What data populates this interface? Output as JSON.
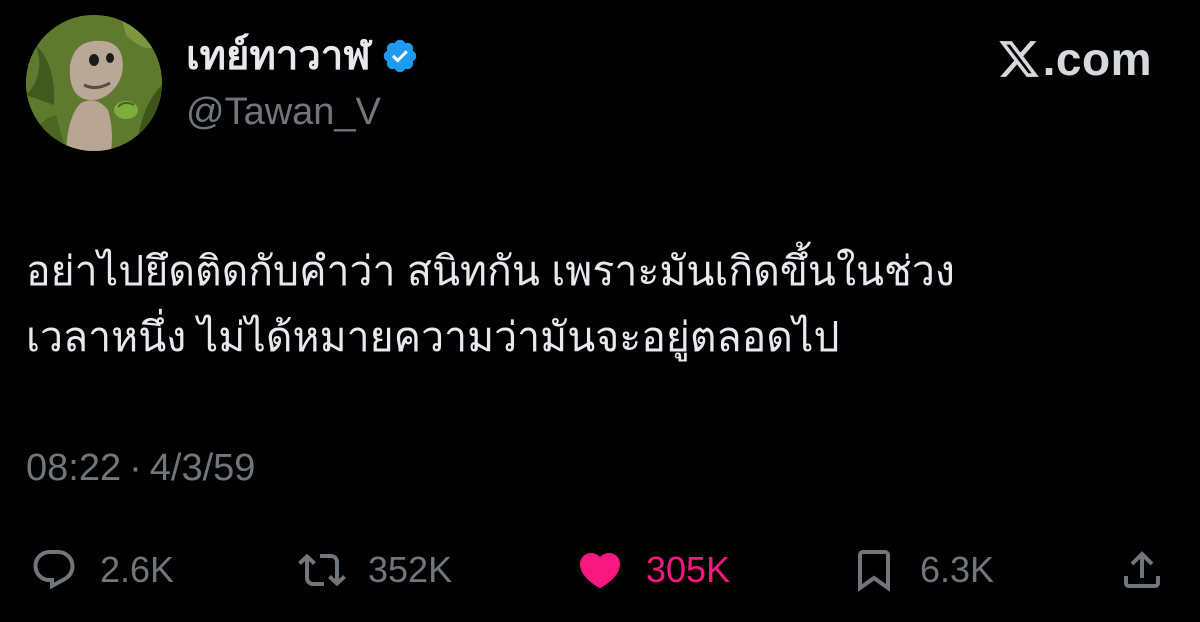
{
  "author": {
    "display_name": "เทย์ทาวาฬ",
    "handle": "@Tawan_V",
    "avatar_icon": "dinosaur-avatar",
    "verified_icon": "verified-badge-icon",
    "verified_color": "#1d9bf0"
  },
  "brand": {
    "logo_icon": "x-logo-icon",
    "text": ".com"
  },
  "tweet": {
    "line1": "อย่าไปยึดติดกับคำว่า สนิทกัน เพราะมันเกิดขึ้นในช่วง",
    "line2": "เวลาหนึ่ง ไม่ได้หมายความว่ามันจะอยู่ตลอดไป"
  },
  "meta": {
    "time": "08:22",
    "separator": "·",
    "date": "4/3/59"
  },
  "actions": {
    "replies": "2.6K",
    "retweets": "352K",
    "likes": "305K",
    "bookmarks": "6.3K",
    "like_color": "#f91880",
    "muted_color": "#71767b"
  }
}
